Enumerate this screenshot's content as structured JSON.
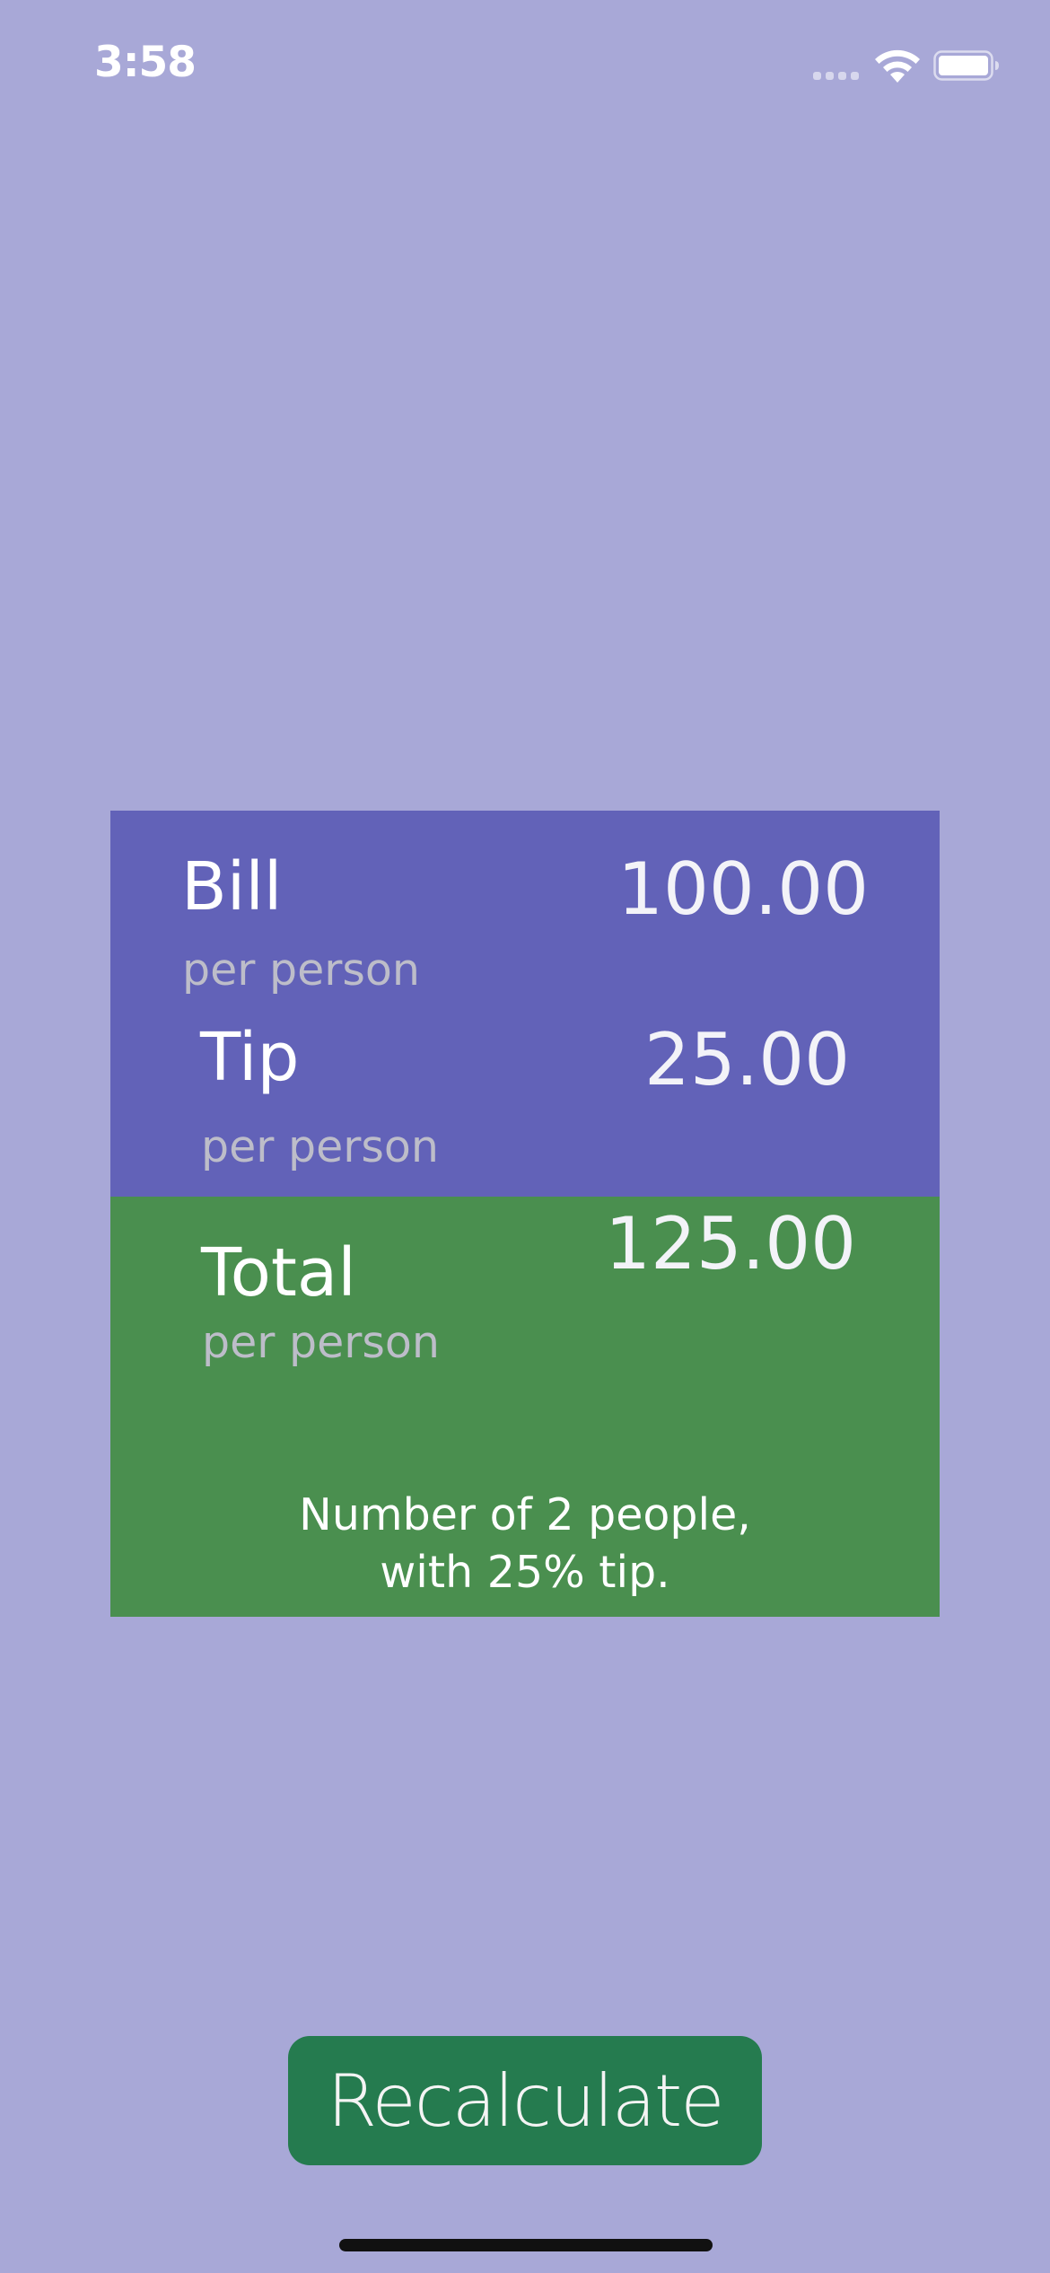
{
  "status_bar": {
    "time": "3:58",
    "signal_icon": "cellular-signal-icon",
    "wifi_icon": "wifi-icon",
    "battery_icon": "battery-icon"
  },
  "bill": {
    "label": "Bill",
    "sublabel": "per person",
    "value": "100.00"
  },
  "tip": {
    "label": "Tip",
    "sublabel": "per person",
    "value": "25.00"
  },
  "total": {
    "label": "Total",
    "sublabel": "per person",
    "value": "125.00"
  },
  "summary": {
    "line1": "Number of 2 people,",
    "line2": "with 25% tip."
  },
  "button": {
    "label": "Recalculate"
  },
  "colors": {
    "background": "#a8a8d7",
    "top_panel": "#6262b8",
    "bottom_panel": "#4a8f4f",
    "button": "#257b4f"
  }
}
